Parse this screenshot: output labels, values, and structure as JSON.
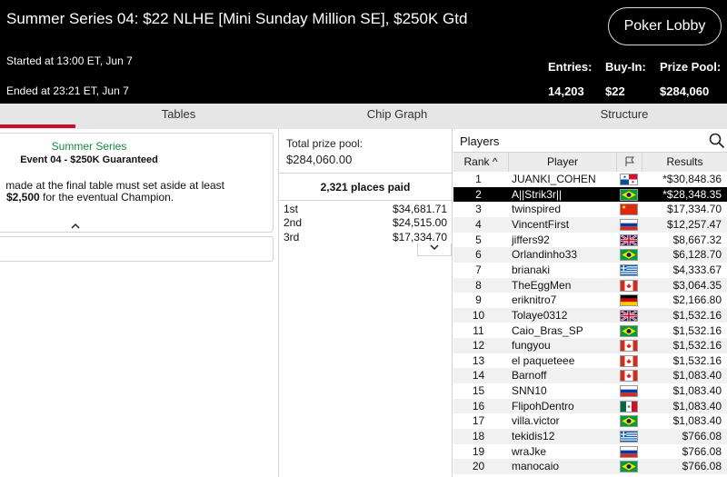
{
  "header": {
    "title": "Summer Series 04: $22 NLHE [Mini Sunday Million SE], $250K Gtd",
    "started": "Started at 13:00 ET, Jun 7",
    "ended": "Ended at 23:21 ET, Jun 7",
    "lobby_button": "Poker Lobby",
    "entries_label": "Entries:",
    "entries_value": "14,203",
    "buyin_label": "Buy-In:",
    "buyin_value": "$22",
    "prizepool_label": "Prize Pool:",
    "prizepool_value": "$284,060"
  },
  "tabs": [
    {
      "label": "Tables",
      "active": true
    },
    {
      "label": "Chip Graph",
      "active": false
    },
    {
      "label": "Structure",
      "active": false
    }
  ],
  "info": {
    "series": "Summer Series",
    "event": "Event 04 - $250K Guaranteed",
    "line1": "made at the final table must set aside at least",
    "line2_amount": "$2,500",
    "line2_rest": " for the eventual Champion."
  },
  "prize": {
    "pool_label": "Total prize pool:",
    "pool_value": "$284,060.00",
    "places_paid": "2,321 places paid",
    "payouts": [
      {
        "place": "1st",
        "amount": "$34,681.71"
      },
      {
        "place": "2nd",
        "amount": "$24,515.00"
      },
      {
        "place": "3rd",
        "amount": "$17,334.70"
      }
    ]
  },
  "players": {
    "title": "Players",
    "columns": {
      "rank": "Rank",
      "player": "Player",
      "results": "Results"
    },
    "rows": [
      {
        "rank": "1",
        "name": "JUANKI_COHEN",
        "flag": "panama",
        "result": "*$30,848.36"
      },
      {
        "rank": "2",
        "name": "A||Strik3r||",
        "flag": "brazil",
        "result": "*$28,348.35",
        "selected": true
      },
      {
        "rank": "3",
        "name": "twinspired",
        "flag": "china",
        "result": "$17,334.70"
      },
      {
        "rank": "4",
        "name": "VincentFirst",
        "flag": "russia",
        "result": "$12,257.47"
      },
      {
        "rank": "5",
        "name": "jiffers92",
        "flag": "uk",
        "result": "$8,667.32"
      },
      {
        "rank": "6",
        "name": "Orlandinho33",
        "flag": "brazil",
        "result": "$6,128.70"
      },
      {
        "rank": "7",
        "name": "brianaki",
        "flag": "greece",
        "result": "$4,333.67"
      },
      {
        "rank": "8",
        "name": "TheEggMen",
        "flag": "canada",
        "result": "$3,064.35"
      },
      {
        "rank": "9",
        "name": "eriknitro7",
        "flag": "germany",
        "result": "$2,166.80"
      },
      {
        "rank": "10",
        "name": "Tolaye0312",
        "flag": "uk",
        "result": "$1,532.16"
      },
      {
        "rank": "11",
        "name": "Caio_Bras_SP",
        "flag": "brazil",
        "result": "$1,532.16"
      },
      {
        "rank": "12",
        "name": "fungyou",
        "flag": "canada",
        "result": "$1,532.16"
      },
      {
        "rank": "13",
        "name": "el paqueteee",
        "flag": "canada",
        "result": "$1,532.16"
      },
      {
        "rank": "14",
        "name": "Barnoff",
        "flag": "canada",
        "result": "$1,083.40"
      },
      {
        "rank": "15",
        "name": "SNN10",
        "flag": "russia",
        "result": "$1,083.40"
      },
      {
        "rank": "16",
        "name": "FlipohDentro",
        "flag": "mexico",
        "result": "$1,083.40"
      },
      {
        "rank": "17",
        "name": "villa.victor",
        "flag": "brazil",
        "result": "$1,083.40"
      },
      {
        "rank": "18",
        "name": "tekidis12",
        "flag": "greece",
        "result": "$766.08"
      },
      {
        "rank": "19",
        "name": "wraJke",
        "flag": "russia",
        "result": "$766.08"
      },
      {
        "rank": "20",
        "name": "manocaio",
        "flag": "brazil",
        "result": "$766.08"
      }
    ]
  }
}
